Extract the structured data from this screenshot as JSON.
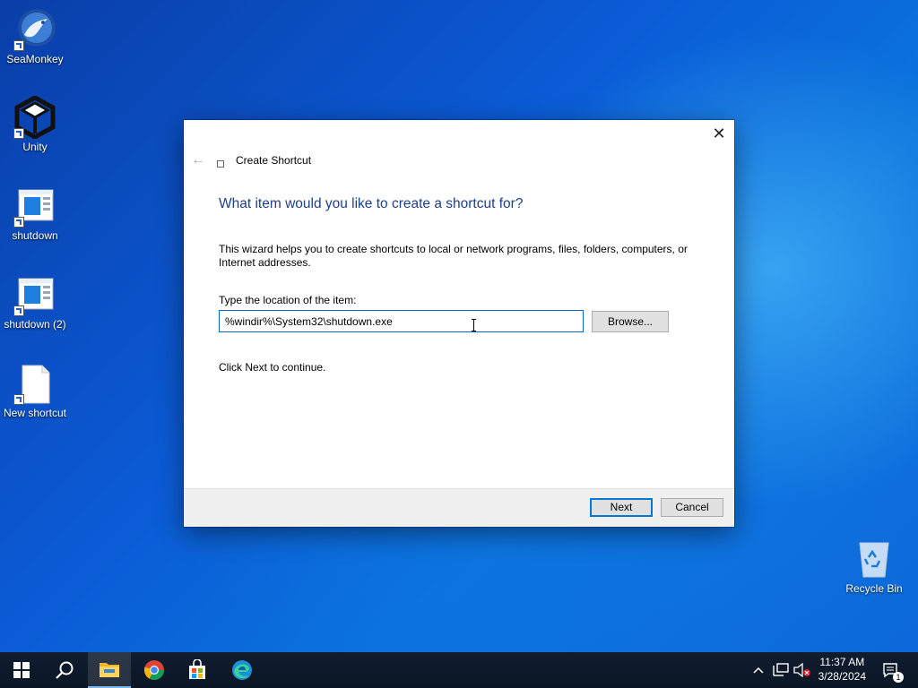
{
  "desktop": {
    "icons": [
      {
        "label": "SeaMonkey",
        "icon": "seamonkey-icon"
      },
      {
        "label": "Unity",
        "icon": "unity-icon"
      },
      {
        "label": "shutdown",
        "icon": "shortcut-window-icon"
      },
      {
        "label": "shutdown (2)",
        "icon": "shortcut-window-icon"
      },
      {
        "label": "New shortcut",
        "icon": "blank-file-icon"
      }
    ],
    "recycle_bin": {
      "label": "Recycle Bin",
      "icon": "recycle-bin-icon"
    }
  },
  "dialog": {
    "title": "Create Shortcut",
    "heading": "What item would you like to create a shortcut for?",
    "description": "This wizard helps you to create shortcuts to local or network programs, files, folders, computers, or Internet addresses.",
    "location_label": "Type the location of the item:",
    "location_value": "%windir%\\System32\\shutdown.exe",
    "browse_label": "Browse...",
    "continue_text": "Click Next to continue.",
    "next_label": "Next",
    "cancel_label": "Cancel",
    "close_glyph": "✕",
    "back_glyph": "←"
  },
  "taskbar": {
    "items": [
      {
        "name": "start-button",
        "icon": "windows-logo-icon"
      },
      {
        "name": "search-button",
        "icon": "search-icon"
      },
      {
        "name": "file-explorer",
        "icon": "folder-icon",
        "active": true
      },
      {
        "name": "chrome",
        "icon": "chrome-icon"
      },
      {
        "name": "microsoft-store",
        "icon": "store-icon"
      },
      {
        "name": "edge",
        "icon": "edge-icon"
      }
    ],
    "clock_time": "11:37 AM",
    "clock_date": "3/28/2024",
    "notification_count": "1"
  },
  "colors": {
    "accent": "#0078d7",
    "heading": "#1e3f8c",
    "taskbar": "#0e1a2b"
  }
}
